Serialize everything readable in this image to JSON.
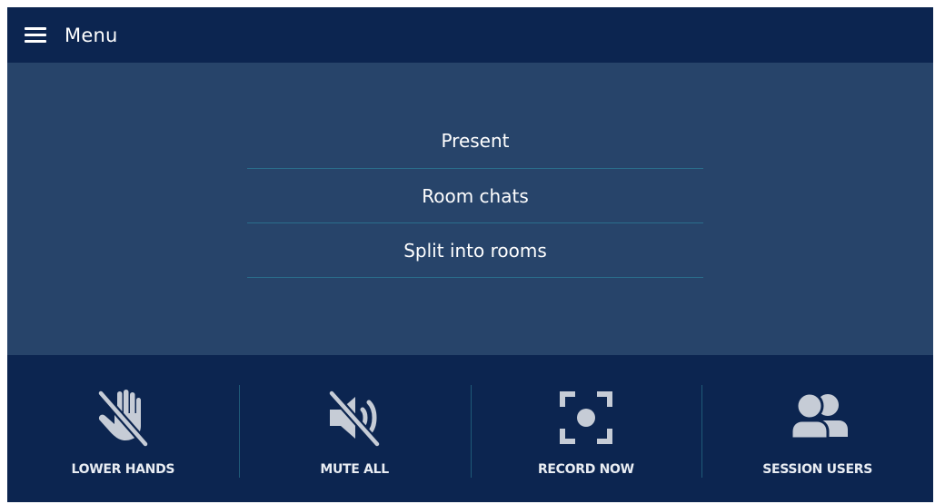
{
  "header": {
    "menu_label": "Menu"
  },
  "menu": {
    "items": [
      {
        "label": "Present"
      },
      {
        "label": "Room chats"
      },
      {
        "label": "Split into rooms"
      }
    ]
  },
  "actions": [
    {
      "label": "LOWER HANDS",
      "icon": "hand-slash-icon"
    },
    {
      "label": "MUTE ALL",
      "icon": "volume-mute-icon"
    },
    {
      "label": "RECORD NOW",
      "icon": "record-icon"
    },
    {
      "label": "SESSION USERS",
      "icon": "users-icon"
    }
  ],
  "colors": {
    "header_bg": "#0c2550",
    "body_bg": "#27446a",
    "divider": "#2a6e8c",
    "icon": "#c6ccd6"
  }
}
